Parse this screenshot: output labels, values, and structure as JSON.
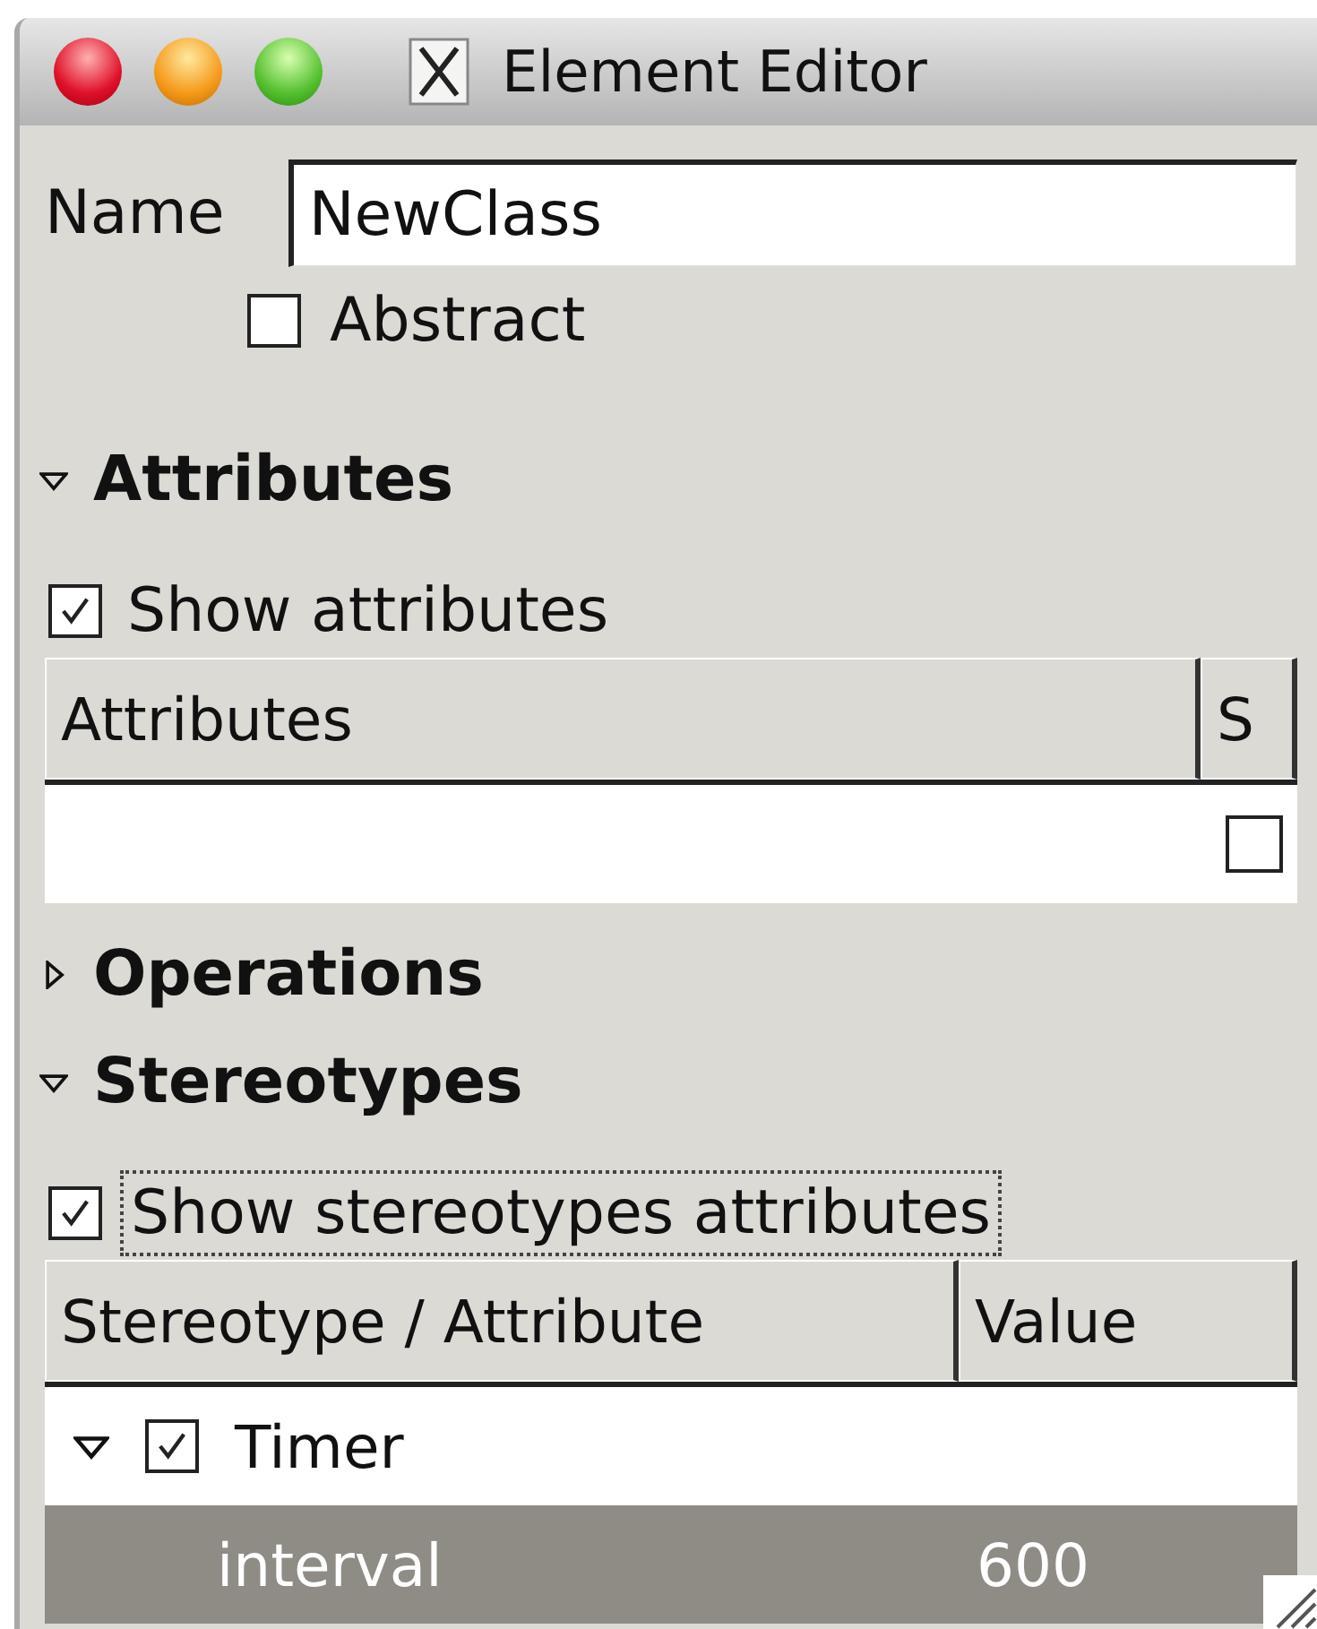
{
  "window": {
    "title": "Element Editor"
  },
  "name_field": {
    "label": "Name",
    "value": "NewClass"
  },
  "abstract": {
    "label": "Abstract",
    "checked": false
  },
  "sections": [
    {
      "kind": "attributes",
      "title": "Attributes",
      "expanded": true,
      "show": {
        "label": "Show attributes",
        "checked": true,
        "focused": false
      },
      "columns": [
        "Attributes",
        "S"
      ],
      "rows": [
        {
          "checked": false
        }
      ]
    },
    {
      "kind": "operations",
      "title": "Operations",
      "expanded": false
    },
    {
      "kind": "stereotypes",
      "title": "Stereotypes",
      "expanded": true,
      "show": {
        "label": "Show stereotypes attributes",
        "checked": true,
        "focused": true
      },
      "columns": [
        "Stereotype / Attribute",
        "Value"
      ],
      "rows": [
        {
          "name": "Timer",
          "checked": true,
          "expanded": true,
          "selected": false,
          "children": [
            {
              "name": "interval",
              "value": "600",
              "selected": true
            }
          ]
        }
      ]
    }
  ]
}
